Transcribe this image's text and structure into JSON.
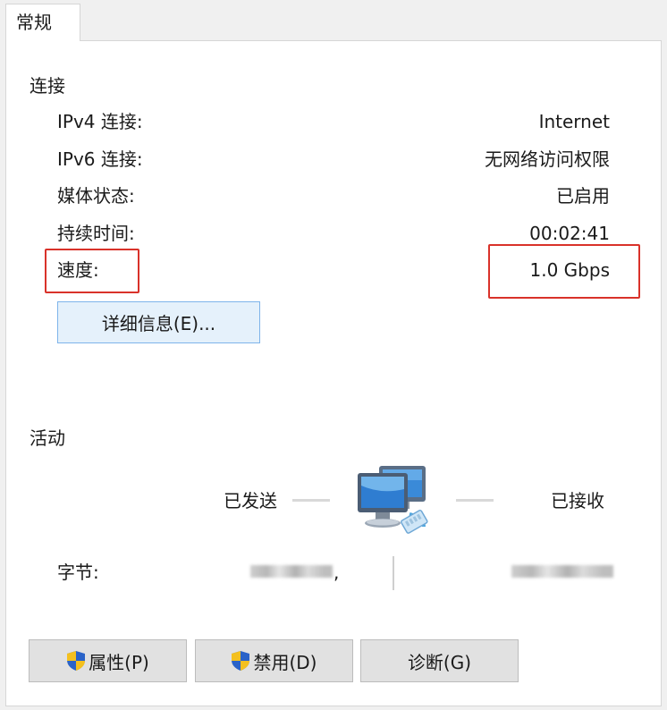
{
  "tab": {
    "label": "常规"
  },
  "connection": {
    "heading": "连接",
    "rows": [
      {
        "label": "IPv4 连接:",
        "value": "Internet"
      },
      {
        "label": "IPv6 连接:",
        "value": "无网络访问权限"
      },
      {
        "label": "媒体状态:",
        "value": "已启用"
      },
      {
        "label": "持续时间:",
        "value": "00:02:41"
      },
      {
        "label": "速度:",
        "value": "1.0 Gbps"
      }
    ],
    "details_button": "详细信息(E)..."
  },
  "activity": {
    "heading": "活动",
    "sent_label": "已发送",
    "received_label": "已接收",
    "bytes_label": "字节:",
    "bytes_sent_suffix": ","
  },
  "buttons": {
    "properties": "属性(P)",
    "disable": "禁用(D)",
    "diagnose": "诊断(G)"
  },
  "icons": {
    "shield": "uac-shield-icon",
    "network": "network-computers-icon"
  },
  "colors": {
    "highlight": "#d9322a",
    "focus_border": "#7eb4ea"
  }
}
